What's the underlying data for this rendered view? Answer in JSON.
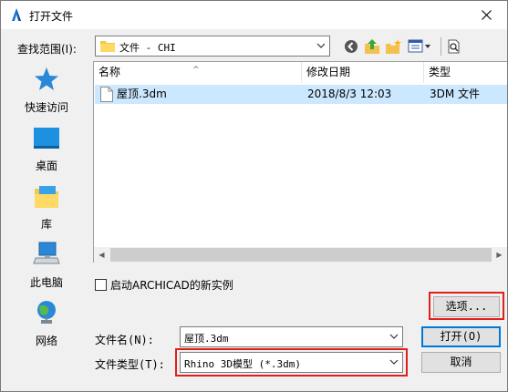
{
  "window": {
    "title": "打开文件",
    "accent": "#0078d7",
    "highlight": "#e0201c"
  },
  "lookin": {
    "label": "查找范围(I):",
    "value": "文件 - CHI"
  },
  "toolbar": {
    "icons": [
      "back-icon",
      "up-folder-icon",
      "new-folder-icon",
      "view-menu-icon",
      "preview-icon"
    ]
  },
  "places": [
    {
      "label": "快速访问",
      "icon": "star-icon"
    },
    {
      "label": "桌面",
      "icon": "desktop-icon"
    },
    {
      "label": "库",
      "icon": "library-icon"
    },
    {
      "label": "此电脑",
      "icon": "computer-icon"
    },
    {
      "label": "网络",
      "icon": "network-icon"
    }
  ],
  "filelist": {
    "columns": [
      "名称",
      "修改日期",
      "类型"
    ],
    "rows": [
      {
        "name": "屋顶.3dm",
        "date": "2018/8/3 12:03",
        "type": "3DM 文件"
      }
    ]
  },
  "checkbox": {
    "label": "启动ARCHICAD的新实例",
    "checked": false
  },
  "buttons": {
    "options": "选项...",
    "open": "打开(O)",
    "cancel": "取消"
  },
  "filename": {
    "label": "文件名(N):",
    "value": "屋顶.3dm"
  },
  "filetype": {
    "label": "文件类型(T):",
    "value": "Rhino 3D模型 (*.3dm)"
  }
}
